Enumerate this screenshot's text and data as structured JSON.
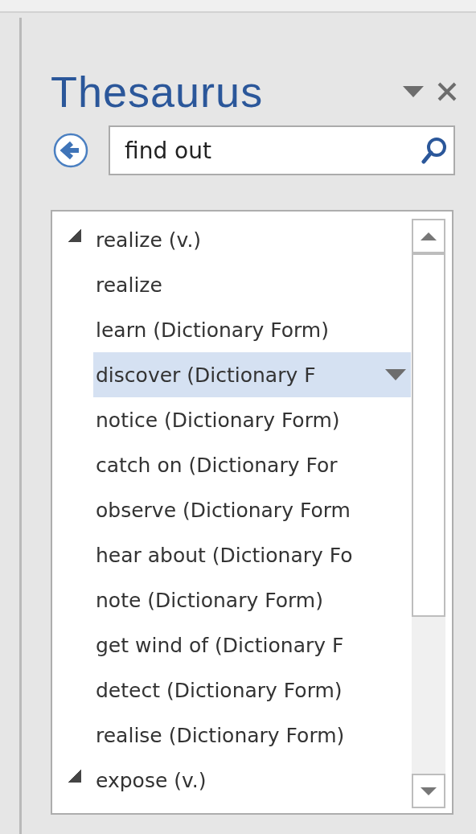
{
  "pane": {
    "title": "Thesaurus"
  },
  "search": {
    "value": "find out"
  },
  "results": [
    {
      "label": "realize (v.)",
      "expanded": true,
      "children": [
        {
          "label": "realize",
          "selected": false
        },
        {
          "label": "learn (Dictionary Form)",
          "selected": false
        },
        {
          "label": "discover (Dictionary F",
          "selected": true
        },
        {
          "label": "notice (Dictionary Form)",
          "selected": false
        },
        {
          "label": "catch on (Dictionary For",
          "selected": false
        },
        {
          "label": "observe (Dictionary Form",
          "selected": false
        },
        {
          "label": "hear about (Dictionary Fo",
          "selected": false
        },
        {
          "label": "note (Dictionary Form)",
          "selected": false
        },
        {
          "label": "get wind of (Dictionary F",
          "selected": false
        },
        {
          "label": "detect (Dictionary Form)",
          "selected": false
        },
        {
          "label": "realise (Dictionary Form)",
          "selected": false
        }
      ]
    },
    {
      "label": "expose (v.)",
      "expanded": true
    }
  ]
}
